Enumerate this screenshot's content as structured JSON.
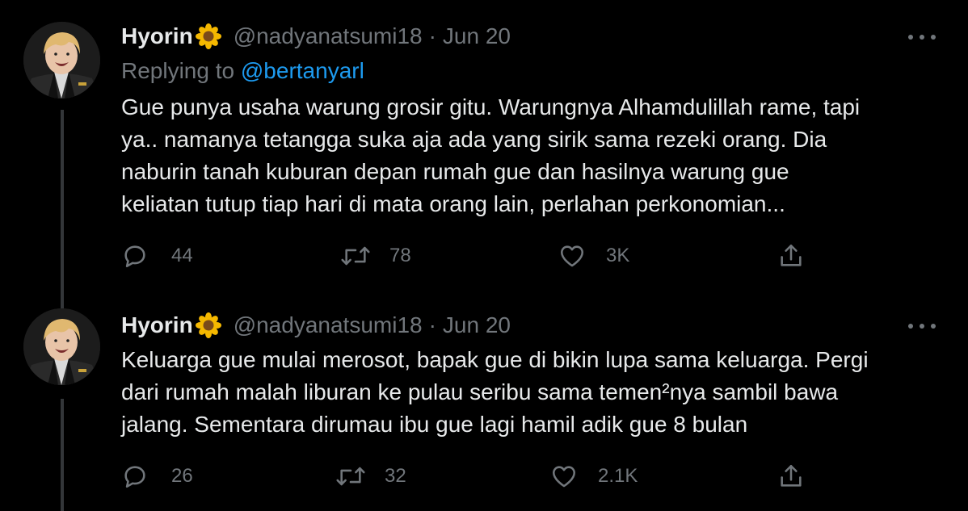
{
  "tweets": [
    {
      "display_name": "Hyorin",
      "name_emoji": "sunflower-icon",
      "handle": "@nadyanatsumi18",
      "separator": "·",
      "date": "Jun 20",
      "reply_prefix": "Replying to",
      "reply_to": "@bertanyarl",
      "lines": [
        "Gue punya usaha warung grosir gitu. Warungnya Alhamdulillah rame, tapi",
        "ya.. namanya tetangga suka aja ada yang sirik sama rezeki orang. Dia",
        "naburin tanah kuburan depan rumah gue dan hasilnya warung gue",
        "keliatan tutup tiap hari di mata orang lain, perlahan perkonomian..."
      ],
      "stats": {
        "replies": "44",
        "retweets": "78",
        "likes": "3K"
      }
    },
    {
      "display_name": "Hyorin",
      "name_emoji": "sunflower-icon",
      "handle": "@nadyanatsumi18",
      "separator": "·",
      "date": "Jun 20",
      "lines": [
        "Keluarga gue mulai merosot, bapak gue di bikin lupa sama keluarga. Pergi",
        "dari rumah malah liburan ke pulau seribu sama temen²nya sambil bawa",
        "jalang. Sementara dirumau ibu gue lagi hamil adik gue 8 bulan"
      ],
      "stats": {
        "replies": "26",
        "retweets": "32",
        "likes": "2.1K"
      }
    }
  ],
  "colors": {
    "background": "#000000",
    "text": "#e7e9ea",
    "muted": "#71767b",
    "link": "#1d9bf0",
    "thread_line": "#333639"
  }
}
